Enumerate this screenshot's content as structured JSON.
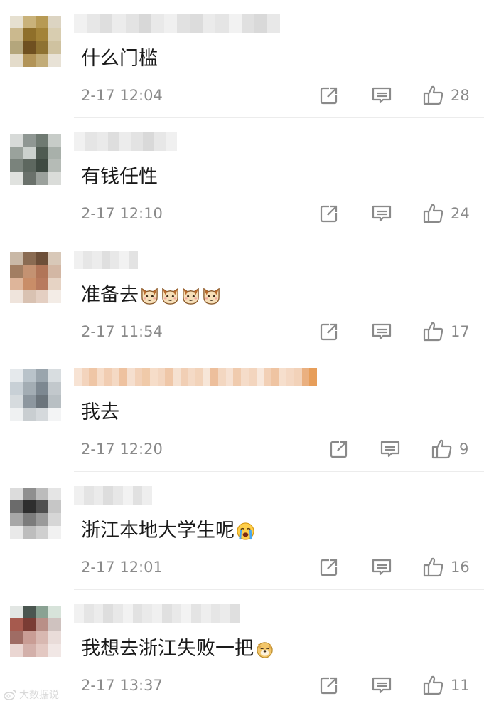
{
  "comments": [
    {
      "text": "什么门槛",
      "emojis": [],
      "time": "2-17 12:04",
      "likes": "28",
      "avatar_colors": [
        "#e6e0d0",
        "#c9b27a",
        "#b79a54",
        "#dcd4c2",
        "#cbb98e",
        "#8f6f2a",
        "#a38338",
        "#d8cdb0",
        "#b4a67c",
        "#6f5020",
        "#8e7232",
        "#cfc2a0",
        "#e4dccb",
        "#b29458",
        "#c2ac78",
        "#e8e2d6"
      ],
      "name_colors": [
        "#f1f1f1",
        "#e7e7e7",
        "#dedede",
        "#ececec",
        "#e3e3e3",
        "#d8d8d8",
        "#e9e9e9",
        "#f0f0f0",
        "#e1e1e1",
        "#dcdcdc",
        "#ebebeb",
        "#e5e5e5",
        "#f2f2f2",
        "#e0e0e0",
        "#d9d9d9",
        "#e8e8e8"
      ]
    },
    {
      "text": "有钱任性",
      "emojis": [],
      "time": "2-17 12:10",
      "likes": "24",
      "avatar_colors": [
        "#d7dad8",
        "#8f9793",
        "#6f7a72",
        "#c7ccc8",
        "#9aa29c",
        "#cbd1cd",
        "#4f5b52",
        "#a8b0aa",
        "#7a837c",
        "#5d675f",
        "#3f4a42",
        "#b5bbb6",
        "#e0e2df",
        "#6a716b",
        "#9ba19c",
        "#dadcd9"
      ],
      "name_colors": [
        "#f1f1f1",
        "#e5e5e5",
        "#eaeaea",
        "#dedede",
        "#ececec",
        "#e3e3e3",
        "#d9d9d9",
        "#e7e7e7",
        "#f0f0f0"
      ]
    },
    {
      "text": "准备去",
      "emojis": [
        "cat",
        "cat",
        "cat",
        "cat"
      ],
      "time": "2-17 11:54",
      "likes": "17",
      "avatar_colors": [
        "#c9b8a6",
        "#8a6b52",
        "#6d4f39",
        "#d8c8b8",
        "#a27e62",
        "#c49272",
        "#b17558",
        "#d3b7a4",
        "#deb59a",
        "#c98d68",
        "#b87a5e",
        "#e6d3c4",
        "#efe4dc",
        "#d9c2b2",
        "#e4cfc2",
        "#f3ece6"
      ],
      "name_colors": [
        "#f0f0f0",
        "#e6e6e6",
        "#ececec",
        "#dfdfdf",
        "#e8e8e8",
        "#f2f2f2",
        "#e3e3e3"
      ]
    },
    {
      "text": "我去",
      "emojis": [],
      "time": "2-17 12:20",
      "likes": "9",
      "avatar_colors": [
        "#e5e9ec",
        "#b9c3ca",
        "#9aa5ad",
        "#d8dde0",
        "#c8d0d6",
        "#a3adb4",
        "#7d8891",
        "#c2c8cc",
        "#d6dbde",
        "#8d979f",
        "#6c757c",
        "#b8bfc3",
        "#eff1f2",
        "#c9ced1",
        "#d5d9dc",
        "#f3f4f5"
      ],
      "name_colors": [
        "#f7e3d4",
        "#f3d4bd",
        "#efc6a6",
        "#f6dcc8",
        "#f1cdb2",
        "#f4d9c4",
        "#eec2a0",
        "#f5dfcf",
        "#f2d1b8",
        "#f0caa9",
        "#f6ddc9",
        "#f3d6c0",
        "#efc7a8",
        "#f5e1d1",
        "#f1cfb5",
        "#f4dac6",
        "#f2d3ba",
        "#f7e6d8",
        "#edbf9c",
        "#f3d7c1",
        "#f6e1d2",
        "#f0cbae",
        "#f5dcc9",
        "#f3d5be",
        "#f8e8dc",
        "#f2d0b6",
        "#efc4a2",
        "#f6dfcd",
        "#f4d8c3",
        "#f2d2b9",
        "#eab080",
        "#e79e5a"
      ]
    },
    {
      "text": "浙江本地大学生呢",
      "emojis": [
        "cry"
      ],
      "time": "2-17 12:01",
      "likes": "16",
      "avatar_colors": [
        "#dcdcdc",
        "#8f8f8f",
        "#bcbcbc",
        "#e5e5e5",
        "#6b6b6b",
        "#2e2e2e",
        "#4f4f4f",
        "#c6c6c6",
        "#a7a7a7",
        "#7c7c7c",
        "#9a9a9a",
        "#d6d6d6",
        "#e9e9e9",
        "#bdbdbd",
        "#cfcfcf",
        "#f1f1f1"
      ],
      "name_colors": [
        "#f0f0f0",
        "#e4e4e4",
        "#ebebeb",
        "#dddddd",
        "#e7e7e7",
        "#f2f2f2",
        "#e1e1e1",
        "#eeeeee"
      ]
    },
    {
      "text": "我想去浙江失败一把",
      "emojis": [
        "doge"
      ],
      "time": "2-17 13:37",
      "likes": "11",
      "avatar_colors": [
        "#e2e6e3",
        "#4a5650",
        "#8aa293",
        "#d7e3da",
        "#a65a4e",
        "#7a3c34",
        "#b98f87",
        "#cfc2bf",
        "#9f6c64",
        "#c99d95",
        "#d8b8b1",
        "#e9dcd9",
        "#ead6d2",
        "#d3b0aa",
        "#e3c8c2",
        "#f1e7e5"
      ],
      "name_colors": [
        "#f1f1f1",
        "#e5e5e5",
        "#ececec",
        "#dedede",
        "#e8e8e8",
        "#f2f2f2",
        "#e2e2e2",
        "#eaeaea",
        "#f0f0f0",
        "#e0e0e0",
        "#e9e9e9",
        "#f3f3f3",
        "#e4e4e4",
        "#eeeeee",
        "#e6e6e6",
        "#ebebeb",
        "#dfdfdf"
      ]
    }
  ],
  "icons": {
    "share": "share-icon",
    "reply": "reply-icon",
    "like": "thumbs-up-icon"
  },
  "watermark": {
    "text": "大数据说"
  }
}
